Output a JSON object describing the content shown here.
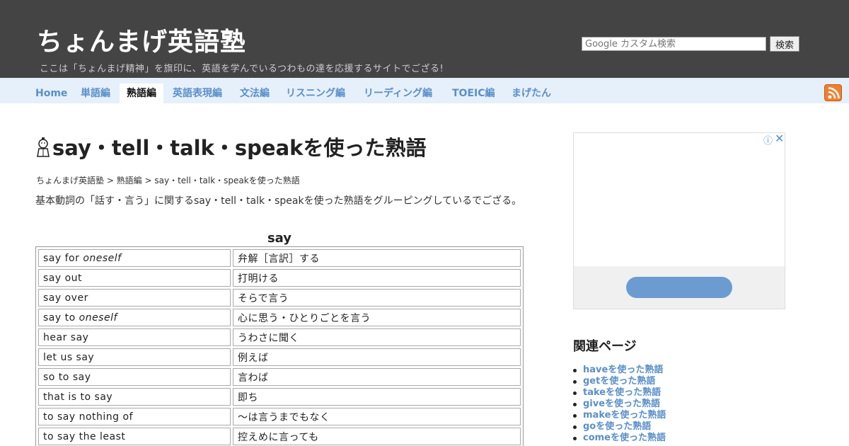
{
  "header": {
    "title": "ちょんまげ英語塾",
    "tagline": "ここは「ちょんまげ精神」を旗印に、英語を学んでいるつわもの達を応援するサイトでござる!",
    "search": {
      "placeholder": "Google カスタム検索",
      "button_label": "検索"
    }
  },
  "nav": {
    "items": [
      {
        "label": "Home"
      },
      {
        "label": "単語編"
      },
      {
        "label": "熟語編"
      },
      {
        "label": "英語表現編"
      },
      {
        "label": "文法編"
      },
      {
        "label": "リスニング編"
      },
      {
        "label": "リーディング編"
      },
      {
        "label": "TOEIC編"
      },
      {
        "label": "まげたん"
      }
    ],
    "active": "熟語編",
    "rss_icon": "rss-icon"
  },
  "main": {
    "title": "say・tell・talk・speakを使った熟語",
    "breadcrumb": "ちょんまげ英語塾 > 熟語編 > say・tell・talk・speakを使った熟語",
    "intro": "基本動詞の「話す・言う」に関するsay・tell・talk・speakを使った熟語をグルーピングしているでござる。",
    "table": {
      "caption": "say",
      "rows": [
        {
          "en": "say for ",
          "en_italic": "oneself",
          "ja": "弁解［言訳］する"
        },
        {
          "en": "say out",
          "en_italic": "",
          "ja": "打明ける"
        },
        {
          "en": "say over",
          "en_italic": "",
          "ja": "そらで言う"
        },
        {
          "en": "say to ",
          "en_italic": "oneself",
          "ja": "心に思う・ひとりごとを言う"
        },
        {
          "en": "hear say",
          "en_italic": "",
          "ja": "うわさに聞く"
        },
        {
          "en": "let us say",
          "en_italic": "",
          "ja": "例えば"
        },
        {
          "en": "so to say",
          "en_italic": "",
          "ja": "言わば"
        },
        {
          "en": "that is to say",
          "en_italic": "",
          "ja": "即ち"
        },
        {
          "en": "to say nothing of",
          "en_italic": "",
          "ja": "～は言うまでもなく"
        },
        {
          "en": "to say the least",
          "en_italic": "",
          "ja": "控えめに言っても"
        }
      ]
    }
  },
  "sidebar": {
    "ad": {
      "info_icon": "ⓘ",
      "close_icon": "✕"
    },
    "related_heading": "関連ページ",
    "related": [
      {
        "label": "haveを使った熟語"
      },
      {
        "label": "getを使った熟語"
      },
      {
        "label": "takeを使った熟語"
      },
      {
        "label": "giveを使った熟語"
      },
      {
        "label": "makeを使った熟語"
      },
      {
        "label": "goを使った熟語"
      },
      {
        "label": "comeを使った熟語"
      }
    ]
  },
  "colors": {
    "header_bg": "#444444",
    "nav_bg": "#e6f0fa",
    "link": "#5b8fc8"
  }
}
